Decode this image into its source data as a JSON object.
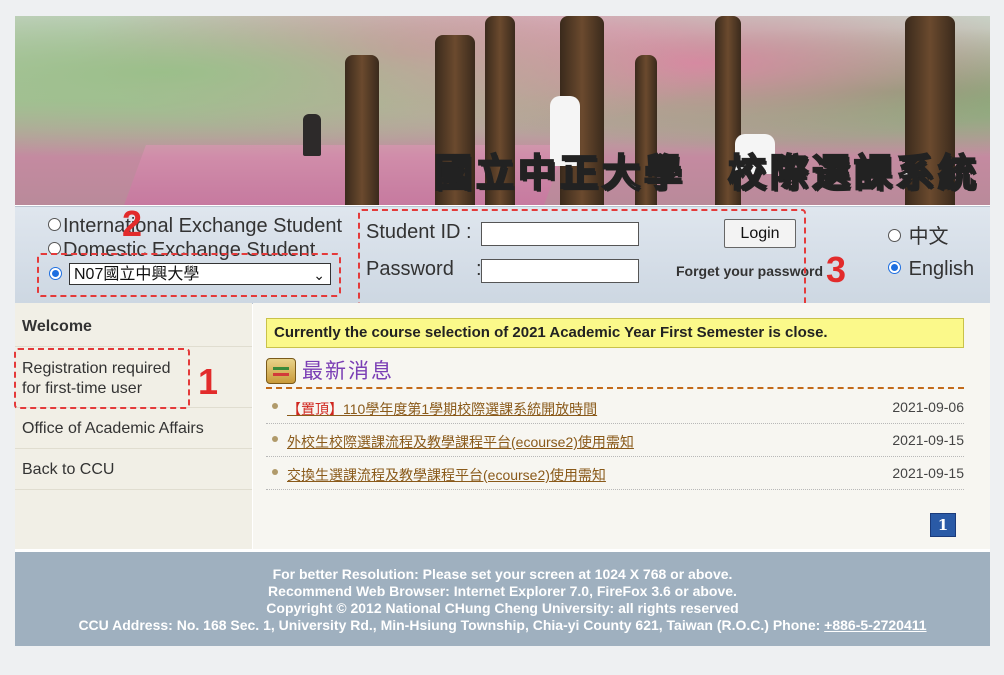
{
  "banner": {
    "title": "國立中正大學　校際選課系統"
  },
  "login": {
    "student_type_options": [
      "International Exchange Student",
      "Domestic Exchange Student"
    ],
    "school_select_value": "N07國立中興大學",
    "student_id_label": "Student ID :",
    "password_label": "Password    :",
    "login_button": "Login",
    "forget_password": "Forget your password",
    "lang_zh": "中文",
    "lang_en": "English"
  },
  "annotations": {
    "n1": "1",
    "n2": "2",
    "n3": "3"
  },
  "sidebar": {
    "items": [
      {
        "label": "Welcome"
      },
      {
        "label_line1": "Registration required",
        "label_line2": "for first-time user"
      },
      {
        "label": "Office of Academic Affairs"
      },
      {
        "label": "Back to CCU"
      }
    ]
  },
  "main": {
    "notice": "Currently the course selection of 2021 Academic Year First Semester is close.",
    "news_heading": "最新消息",
    "news": [
      {
        "pin": "【置頂】",
        "title": "110學年度第1學期校際選課系統開放時間",
        "date": "2021-09-06"
      },
      {
        "title": "外校生校際選課流程及教學課程平台(ecourse2)使用需知",
        "date": "2021-09-15"
      },
      {
        "title": "交換生選課流程及教學課程平台(ecourse2)使用需知",
        "date": "2021-09-15"
      }
    ],
    "page": "1"
  },
  "footer": {
    "line1": "For better Resolution: Please set your screen at 1024 X 768 or above.",
    "line2": "Recommend Web Browser: Internet Explorer 7.0, FireFox 3.6 or above.",
    "line3": "Copyright © 2012 National CHung Cheng University: all rights reserved",
    "line4": "CCU Address: No. 168 Sec. 1, University Rd., Min-Hsiung Township, Chia-yi County 621, Taiwan (R.O.C.)  Phone: ",
    "phone": "+886-5-2720411"
  }
}
